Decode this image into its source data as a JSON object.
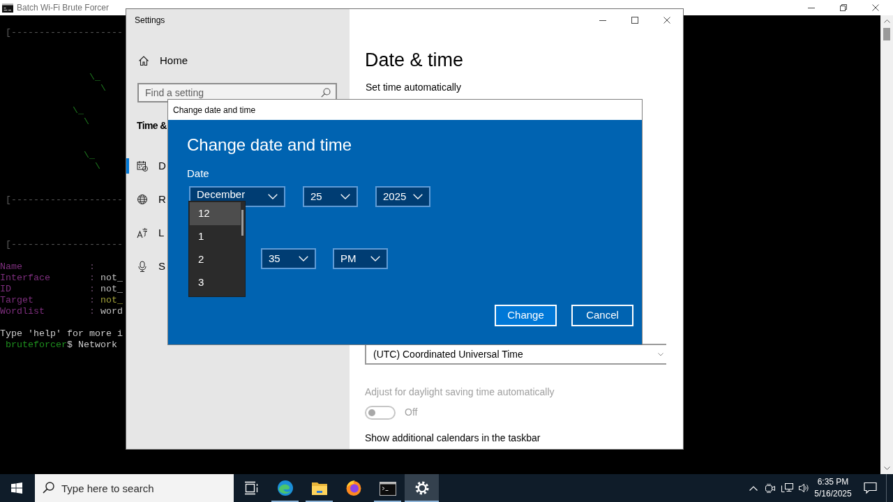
{
  "console_window": {
    "title": "Batch Wi-Fi Brute Forcer",
    "blocks": [
      {
        "kind": "rule",
        "text": " [--------------------"
      },
      {
        "kind": "art",
        "lines": [
          "                \\_",
          "                  \\"
        ]
      },
      {
        "kind": "art",
        "lines": [
          "             \\_",
          "               \\"
        ]
      },
      {
        "kind": "art",
        "lines": [
          "               \\_",
          "                 \\"
        ]
      },
      {
        "kind": "rule",
        "text": " [--------------------"
      },
      {
        "kind": "rule",
        "text": " [--------------------"
      },
      {
        "kind": "fields",
        "rows": [
          {
            "label": "Name",
            "separator": ":"
          },
          {
            "label": "Interface",
            "separator": ":",
            "value": "not_",
            "color": "#c0c0c0"
          },
          {
            "label": "ID",
            "separator": ":",
            "value": "not_",
            "color": "#c0c0c0"
          },
          {
            "label": "Target",
            "separator": ":",
            "value": "not_",
            "color": "#a3a33a"
          },
          {
            "label": "Wordlist",
            "separator": ":",
            "value": "word",
            "color": "#c0c0c0"
          }
        ]
      },
      {
        "kind": "text",
        "text": "Type 'help' for more i"
      },
      {
        "kind": "prompt",
        "user": "bruteforcer",
        "command": "$ Network"
      }
    ]
  },
  "settings_window": {
    "title": "Settings",
    "home": "Home",
    "search": {
      "placeholder": "Find a setting"
    },
    "section": "Time &",
    "nav": [
      {
        "kind": "date_time",
        "label": "D",
        "selected": true
      },
      {
        "kind": "region",
        "label": "R",
        "selected": false
      },
      {
        "kind": "language",
        "label": "L",
        "selected": false
      },
      {
        "kind": "speech",
        "label": "S",
        "selected": false
      }
    ],
    "heading": "Date & time",
    "set_time_label": "Set time automatically",
    "time_zone": {
      "value": "(UTC) Coordinated Universal Time"
    },
    "dst": {
      "label": "Adjust for daylight saving time automatically",
      "disabled": true,
      "on": false,
      "state_label": "Off"
    },
    "calendars_label": "Show additional calendars in the taskbar"
  },
  "dialog": {
    "title": "Change date and time",
    "heading": "Change date and time",
    "date_label": "Date",
    "date_fields": [
      "December",
      "25",
      "2025"
    ],
    "time_fields": [
      "35",
      "PM"
    ],
    "open_list": {
      "items": [
        {
          "label": "12",
          "selected": true
        },
        {
          "label": "1",
          "selected": false
        },
        {
          "label": "2",
          "selected": false
        },
        {
          "label": "3",
          "selected": false
        }
      ]
    },
    "buttons": [
      {
        "label": "Change",
        "kind": "primary"
      },
      {
        "label": "Cancel",
        "kind": "secondary"
      }
    ]
  },
  "taskbar": {
    "search": {
      "placeholder": "Type here to search"
    },
    "buttons": [
      {
        "kind": "task_view",
        "running": false,
        "selected": false
      },
      {
        "kind": "edge",
        "running": true,
        "selected": false
      },
      {
        "kind": "explorer",
        "running": true,
        "selected": false
      },
      {
        "kind": "firefox",
        "running": false,
        "selected": false
      },
      {
        "kind": "console",
        "running": true,
        "selected": false
      },
      {
        "kind": "settings",
        "running": true,
        "selected": true
      }
    ],
    "clock": {
      "time": "6:35 PM",
      "date": "5/16/2025"
    }
  }
}
